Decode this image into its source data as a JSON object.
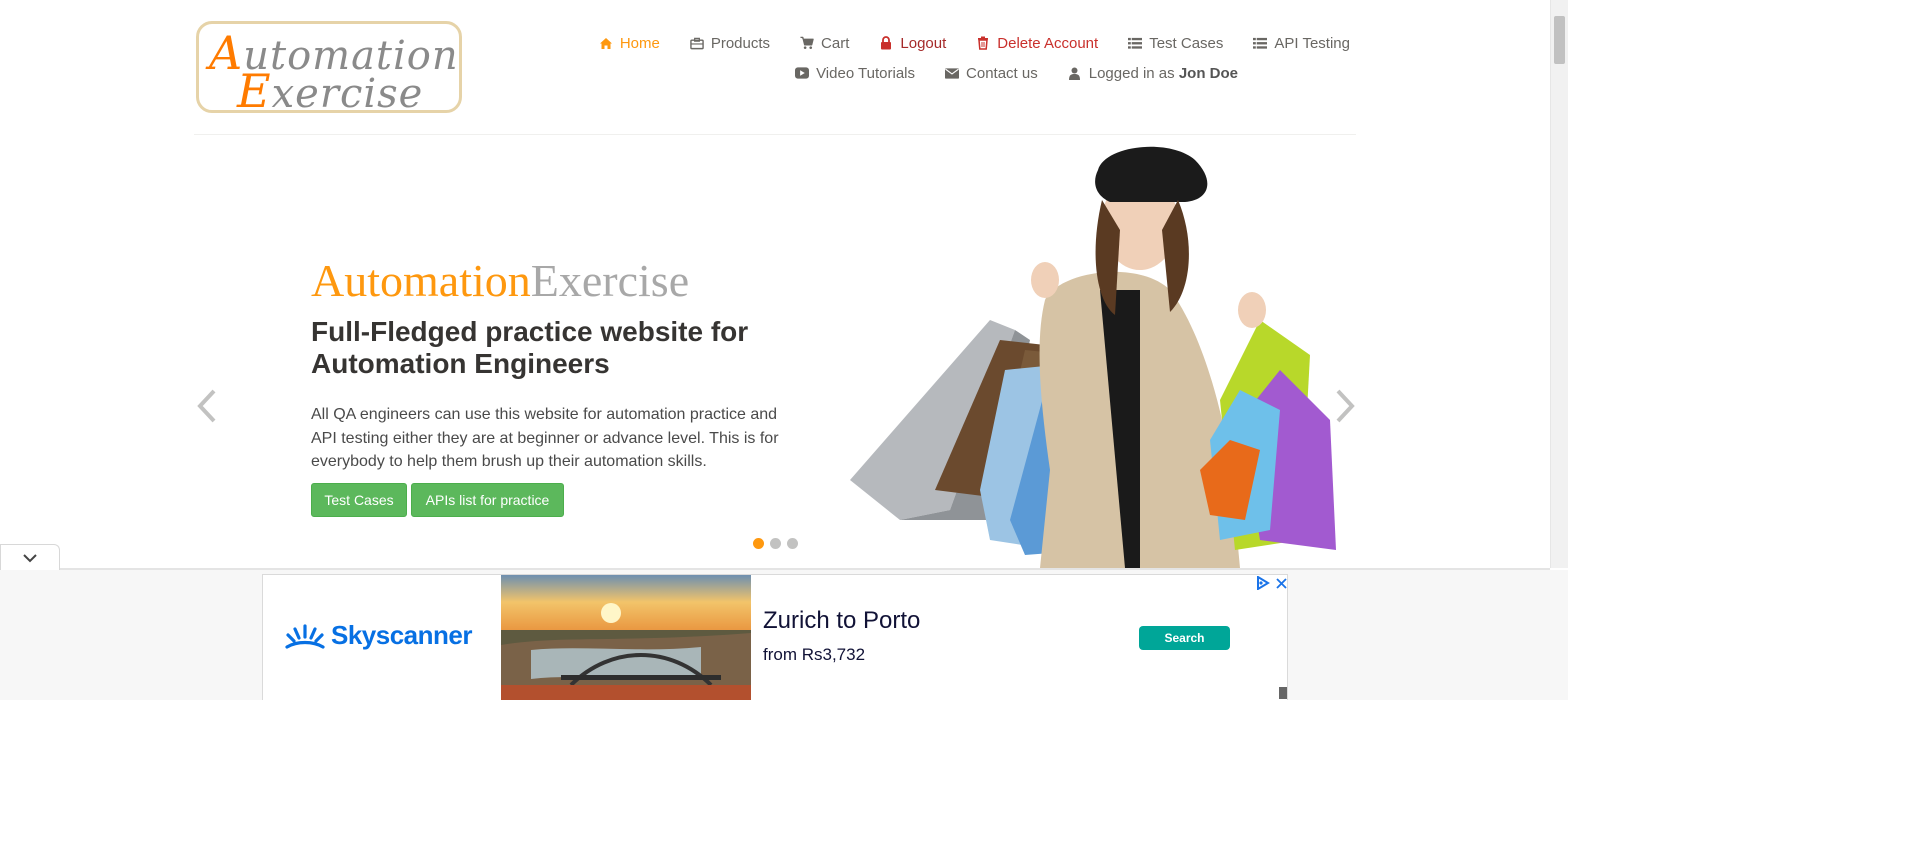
{
  "logo": {
    "line1": "utomation",
    "line1_cap": "A",
    "line2": "xercise",
    "line2_cap": "E"
  },
  "nav": {
    "home": "Home",
    "products": "Products",
    "cart": "Cart",
    "logout": "Logout",
    "delete_account": "Delete Account",
    "test_cases": "Test Cases",
    "api_testing": "API Testing",
    "video_tutorials": "Video Tutorials",
    "contact_us": "Contact us",
    "logged_in_prefix": "Logged in as",
    "logged_in_user": "Jon Doe"
  },
  "slider": {
    "title_part1": "Automation",
    "title_part2": "Exercise",
    "heading": "Full-Fledged practice website for Automation Engineers",
    "description": "All QA engineers can use this website for automation practice and API testing either they are at beginner or advance level. This is for everybody to help them brush up their automation skills.",
    "btn_test_cases": "Test Cases",
    "btn_apis": "APIs list for practice",
    "slide_count": 3,
    "active_slide": 1
  },
  "ad": {
    "brand": "Skyscanner",
    "destination": "Zurich to Porto",
    "price": "from Rs3,732",
    "search_label": "Search"
  },
  "colors": {
    "accent": "#fe980f",
    "danger": "#a52a2a",
    "button_green": "#5cb85c",
    "ad_blue": "#0770e3",
    "ad_teal": "#00a698"
  }
}
